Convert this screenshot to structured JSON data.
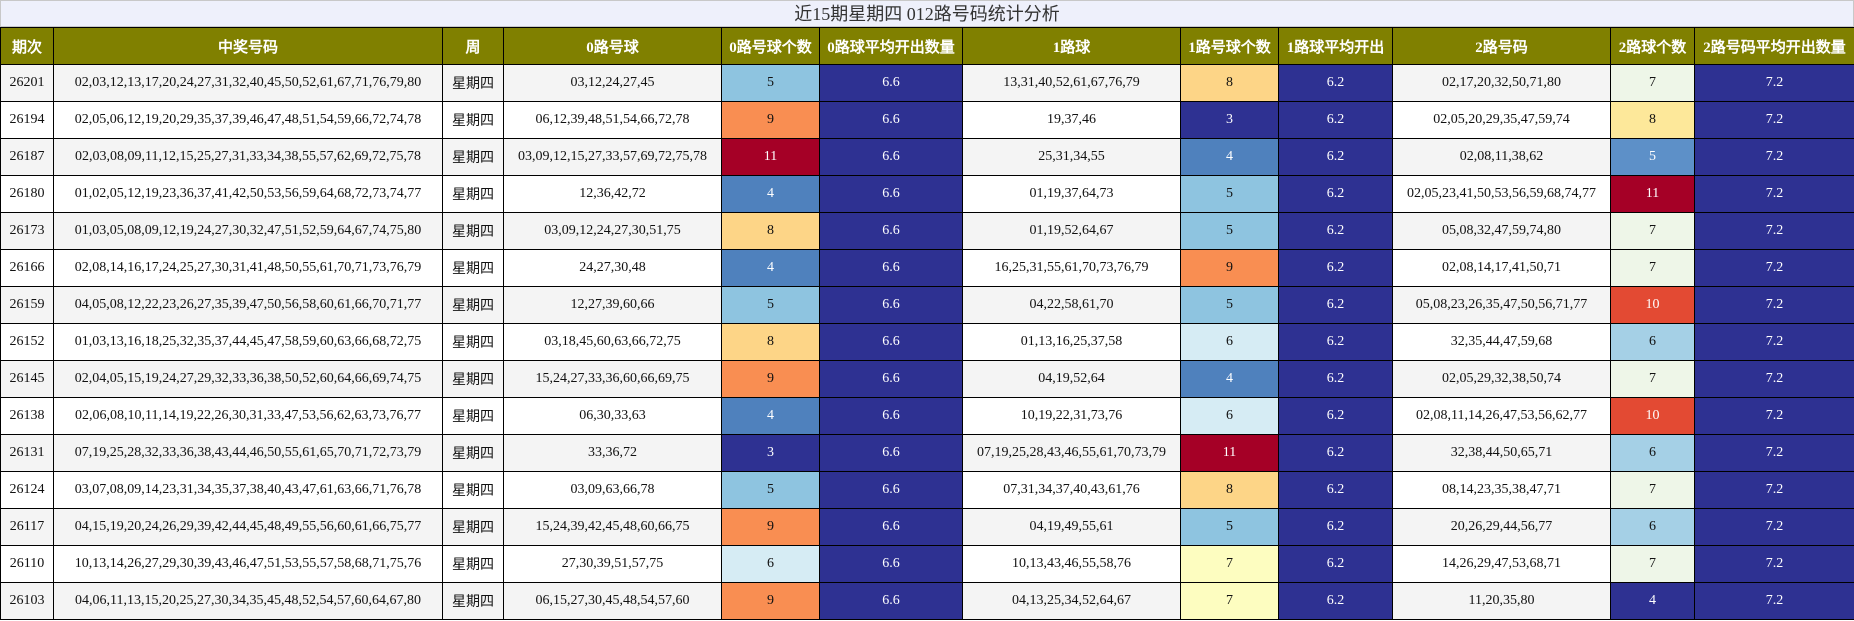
{
  "title": "近15期星期四 012路号码统计分析",
  "headers": [
    "期次",
    "中奖号码",
    "周",
    "0路号球",
    "0路号球个数",
    "0路球平均开出数量",
    "1路球",
    "1路号球个数",
    "1路球平均开出",
    "2路号码",
    "2路球个数",
    "2路号码平均开出数量"
  ],
  "colors": {
    "header_bg": "#808000",
    "avg_bg": "#2e3192",
    "count_scale": {
      "3": "#2e3192",
      "4": "#4f81bd",
      "5": "#8ec4e0",
      "6": "#d6ecf4",
      "7": "#fdfdc0",
      "8": "#fdd587",
      "9": "#f98e52",
      "10": "#e34a33",
      "11": "#a50026"
    },
    "count_scale_2": {
      "4": "#2e3192",
      "5": "#5d90c8",
      "6": "#a5d0e6",
      "7": "#eef6e8",
      "8": "#fde89a",
      "10": "#e34a33",
      "11": "#a50026"
    }
  },
  "chart_data": {
    "type": "table",
    "title": "近15期星期四 012路号码统计分析",
    "rows": [
      {
        "period": "26201",
        "numbers": "02,03,12,13,17,20,24,27,31,32,40,45,50,52,61,67,71,76,79,80",
        "week": "星期四",
        "r0": "03,12,24,27,45",
        "r0_count": 5,
        "r0_avg": "6.6",
        "r1": "13,31,40,52,61,67,76,79",
        "r1_count": 8,
        "r1_avg": "6.2",
        "r2": "02,17,20,32,50,71,80",
        "r2_count": 7,
        "r2_avg": "7.2"
      },
      {
        "period": "26194",
        "numbers": "02,05,06,12,19,20,29,35,37,39,46,47,48,51,54,59,66,72,74,78",
        "week": "星期四",
        "r0": "06,12,39,48,51,54,66,72,78",
        "r0_count": 9,
        "r0_avg": "6.6",
        "r1": "19,37,46",
        "r1_count": 3,
        "r1_avg": "6.2",
        "r2": "02,05,20,29,35,47,59,74",
        "r2_count": 8,
        "r2_avg": "7.2"
      },
      {
        "period": "26187",
        "numbers": "02,03,08,09,11,12,15,25,27,31,33,34,38,55,57,62,69,72,75,78",
        "week": "星期四",
        "r0": "03,09,12,15,27,33,57,69,72,75,78",
        "r0_count": 11,
        "r0_avg": "6.6",
        "r1": "25,31,34,55",
        "r1_count": 4,
        "r1_avg": "6.2",
        "r2": "02,08,11,38,62",
        "r2_count": 5,
        "r2_avg": "7.2"
      },
      {
        "period": "26180",
        "numbers": "01,02,05,12,19,23,36,37,41,42,50,53,56,59,64,68,72,73,74,77",
        "week": "星期四",
        "r0": "12,36,42,72",
        "r0_count": 4,
        "r0_avg": "6.6",
        "r1": "01,19,37,64,73",
        "r1_count": 5,
        "r1_avg": "6.2",
        "r2": "02,05,23,41,50,53,56,59,68,74,77",
        "r2_count": 11,
        "r2_avg": "7.2"
      },
      {
        "period": "26173",
        "numbers": "01,03,05,08,09,12,19,24,27,30,32,47,51,52,59,64,67,74,75,80",
        "week": "星期四",
        "r0": "03,09,12,24,27,30,51,75",
        "r0_count": 8,
        "r0_avg": "6.6",
        "r1": "01,19,52,64,67",
        "r1_count": 5,
        "r1_avg": "6.2",
        "r2": "05,08,32,47,59,74,80",
        "r2_count": 7,
        "r2_avg": "7.2"
      },
      {
        "period": "26166",
        "numbers": "02,08,14,16,17,24,25,27,30,31,41,48,50,55,61,70,71,73,76,79",
        "week": "星期四",
        "r0": "24,27,30,48",
        "r0_count": 4,
        "r0_avg": "6.6",
        "r1": "16,25,31,55,61,70,73,76,79",
        "r1_count": 9,
        "r1_avg": "6.2",
        "r2": "02,08,14,17,41,50,71",
        "r2_count": 7,
        "r2_avg": "7.2"
      },
      {
        "period": "26159",
        "numbers": "04,05,08,12,22,23,26,27,35,39,47,50,56,58,60,61,66,70,71,77",
        "week": "星期四",
        "r0": "12,27,39,60,66",
        "r0_count": 5,
        "r0_avg": "6.6",
        "r1": "04,22,58,61,70",
        "r1_count": 5,
        "r1_avg": "6.2",
        "r2": "05,08,23,26,35,47,50,56,71,77",
        "r2_count": 10,
        "r2_avg": "7.2"
      },
      {
        "period": "26152",
        "numbers": "01,03,13,16,18,25,32,35,37,44,45,47,58,59,60,63,66,68,72,75",
        "week": "星期四",
        "r0": "03,18,45,60,63,66,72,75",
        "r0_count": 8,
        "r0_avg": "6.6",
        "r1": "01,13,16,25,37,58",
        "r1_count": 6,
        "r1_avg": "6.2",
        "r2": "32,35,44,47,59,68",
        "r2_count": 6,
        "r2_avg": "7.2"
      },
      {
        "period": "26145",
        "numbers": "02,04,05,15,19,24,27,29,32,33,36,38,50,52,60,64,66,69,74,75",
        "week": "星期四",
        "r0": "15,24,27,33,36,60,66,69,75",
        "r0_count": 9,
        "r0_avg": "6.6",
        "r1": "04,19,52,64",
        "r1_count": 4,
        "r1_avg": "6.2",
        "r2": "02,05,29,32,38,50,74",
        "r2_count": 7,
        "r2_avg": "7.2"
      },
      {
        "period": "26138",
        "numbers": "02,06,08,10,11,14,19,22,26,30,31,33,47,53,56,62,63,73,76,77",
        "week": "星期四",
        "r0": "06,30,33,63",
        "r0_count": 4,
        "r0_avg": "6.6",
        "r1": "10,19,22,31,73,76",
        "r1_count": 6,
        "r1_avg": "6.2",
        "r2": "02,08,11,14,26,47,53,56,62,77",
        "r2_count": 10,
        "r2_avg": "7.2"
      },
      {
        "period": "26131",
        "numbers": "07,19,25,28,32,33,36,38,43,44,46,50,55,61,65,70,71,72,73,79",
        "week": "星期四",
        "r0": "33,36,72",
        "r0_count": 3,
        "r0_avg": "6.6",
        "r1": "07,19,25,28,43,46,55,61,70,73,79",
        "r1_count": 11,
        "r1_avg": "6.2",
        "r2": "32,38,44,50,65,71",
        "r2_count": 6,
        "r2_avg": "7.2"
      },
      {
        "period": "26124",
        "numbers": "03,07,08,09,14,23,31,34,35,37,38,40,43,47,61,63,66,71,76,78",
        "week": "星期四",
        "r0": "03,09,63,66,78",
        "r0_count": 5,
        "r0_avg": "6.6",
        "r1": "07,31,34,37,40,43,61,76",
        "r1_count": 8,
        "r1_avg": "6.2",
        "r2": "08,14,23,35,38,47,71",
        "r2_count": 7,
        "r2_avg": "7.2"
      },
      {
        "period": "26117",
        "numbers": "04,15,19,20,24,26,29,39,42,44,45,48,49,55,56,60,61,66,75,77",
        "week": "星期四",
        "r0": "15,24,39,42,45,48,60,66,75",
        "r0_count": 9,
        "r0_avg": "6.6",
        "r1": "04,19,49,55,61",
        "r1_count": 5,
        "r1_avg": "6.2",
        "r2": "20,26,29,44,56,77",
        "r2_count": 6,
        "r2_avg": "7.2"
      },
      {
        "period": "26110",
        "numbers": "10,13,14,26,27,29,30,39,43,46,47,51,53,55,57,58,68,71,75,76",
        "week": "星期四",
        "r0": "27,30,39,51,57,75",
        "r0_count": 6,
        "r0_avg": "6.6",
        "r1": "10,13,43,46,55,58,76",
        "r1_count": 7,
        "r1_avg": "6.2",
        "r2": "14,26,29,47,53,68,71",
        "r2_count": 7,
        "r2_avg": "7.2"
      },
      {
        "period": "26103",
        "numbers": "04,06,11,13,15,20,25,27,30,34,35,45,48,52,54,57,60,64,67,80",
        "week": "星期四",
        "r0": "06,15,27,30,45,48,54,57,60",
        "r0_count": 9,
        "r0_avg": "6.6",
        "r1": "04,13,25,34,52,64,67",
        "r1_count": 7,
        "r1_avg": "6.2",
        "r2": "11,20,35,80",
        "r2_count": 4,
        "r2_avg": "7.2"
      }
    ]
  }
}
